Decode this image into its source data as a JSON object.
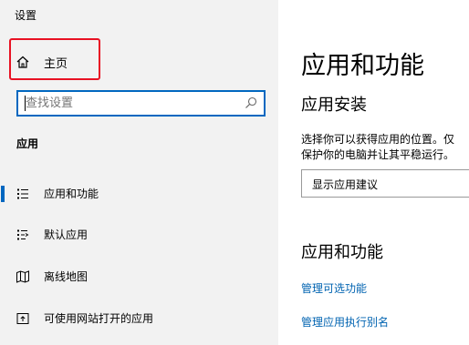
{
  "window": {
    "title": "设置"
  },
  "sidebar": {
    "home_label": "主页",
    "search_placeholder": "查找设置",
    "section_header": "应用",
    "items": [
      {
        "label": "应用和功能",
        "icon": "apps-features-icon",
        "active": true
      },
      {
        "label": "默认应用",
        "icon": "default-apps-icon",
        "active": false
      },
      {
        "label": "离线地图",
        "icon": "offline-maps-icon",
        "active": false
      },
      {
        "label": "可使用网站打开的应用",
        "icon": "apps-for-websites-icon",
        "active": false
      }
    ]
  },
  "main": {
    "title": "应用和功能",
    "install_header": "应用安装",
    "install_desc_line1": "选择你可以获得应用的位置。仅",
    "install_desc_line2": "保护你的电脑并让其平稳运行。",
    "dropdown_value": "显示应用建议",
    "features_header": "应用和功能",
    "links": [
      "管理可选功能",
      "管理应用执行别名"
    ]
  },
  "colors": {
    "accent": "#0067c0",
    "highlight_border": "#e81123",
    "link": "#0063b1",
    "sidebar_bg": "#f2f2f2"
  }
}
